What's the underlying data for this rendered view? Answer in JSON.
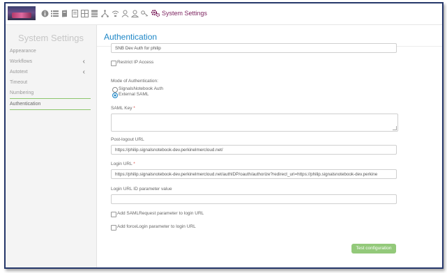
{
  "topbar": {
    "title": "System Settings",
    "icons": [
      "info-icon",
      "list-icon",
      "notebook-icon",
      "document-icon",
      "grid-icon",
      "table-icon",
      "hierarchy-icon",
      "network-icon",
      "user-icon",
      "user-outline-icon",
      "key-icon"
    ],
    "accent": "#7a1f5c"
  },
  "sidebar": {
    "title": "System Settings",
    "items": [
      {
        "label": "Appearance",
        "chevron": ""
      },
      {
        "label": "Workflows",
        "chevron": "‹"
      },
      {
        "label": "Autotext",
        "chevron": "‹"
      },
      {
        "label": "Timeout",
        "chevron": ""
      },
      {
        "label": "Numbering",
        "chevron": ""
      },
      {
        "label": "Authentication",
        "chevron": ""
      }
    ],
    "active_separator_color": "#8cc56b"
  },
  "main": {
    "title": "Authentication",
    "top_field_value": "SNB Dev Auth for philip",
    "restrict_ip_label": "Restrict IP Access",
    "mode_label": "Mode of Authentication:",
    "mode_options": [
      {
        "label": "SignalsNotebook Auth",
        "selected": false
      },
      {
        "label": "External SAML",
        "selected": true
      }
    ],
    "saml_key_label": "SAML Key",
    "required_mark": "*",
    "post_logout_label": "Post-logout URL",
    "post_logout_value": "https://philip.signalsnotebook-dev.perkinelmercloud.net/",
    "login_url_label": "Login URL",
    "login_url_value": "https://philip.signalsnotebook-dev.perkinelmercloud.net/authIDP/oauth/authorize?redirect_uri=https://philip.signalsnotebook-dev.perkine",
    "login_url_id_label": "Login URL ID parameter value",
    "login_url_id_value": "",
    "saml_request_label": "Add SAMLRequest parameter to login URL",
    "force_login_label": "Add forceLogin parameter to login URL",
    "test_button_label": "Test configuration",
    "button_color": "#93c97a",
    "title_color": "#1d86c6"
  }
}
